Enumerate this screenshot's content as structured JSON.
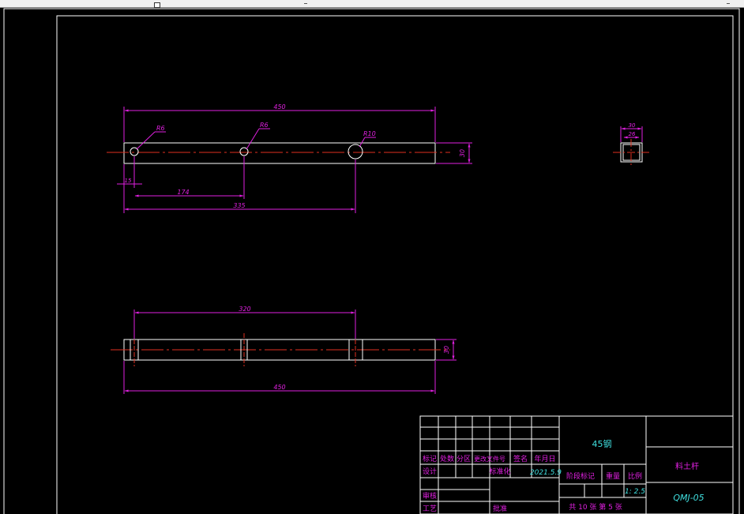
{
  "colors": {
    "background": "#000000",
    "outline": "#ffffff",
    "dimension": "#e020e0",
    "centerline": "#e03020",
    "title_text": "#e020e0",
    "value_text": "#40e0e0"
  },
  "view_top": {
    "dim_overall": "450",
    "label_hole1": "R6",
    "label_hole2": "R6",
    "label_hole3": "R10",
    "dim_hole1_offset": "15",
    "dim_hole2": "174",
    "dim_hole3": "335",
    "dim_height": "30"
  },
  "view_front": {
    "dim_span": "320",
    "dim_overall": "450",
    "dim_height": "30"
  },
  "view_side": {
    "dim_outer": "30",
    "dim_inner": "26"
  },
  "title_block": {
    "material": "45钢",
    "part_name": "料土杆",
    "drawing_number": "QMJ-05",
    "hdr_mark": "标记",
    "hdr_count": "处数",
    "hdr_zone": "分区",
    "hdr_change_doc": "更改文件号",
    "hdr_sign": "签名",
    "hdr_date": "年月日",
    "design_label": "设计",
    "standardize_label": "标准化",
    "date_value": "2021.5.9",
    "stage_label": "阶段标记",
    "weight_label": "重量",
    "scale_label": "比例",
    "scale_value": "1: 2.5",
    "review_label": "审核",
    "process_label": "工艺",
    "approve_label": "批准",
    "sheet_info": "共 10 张 第 5 张"
  }
}
